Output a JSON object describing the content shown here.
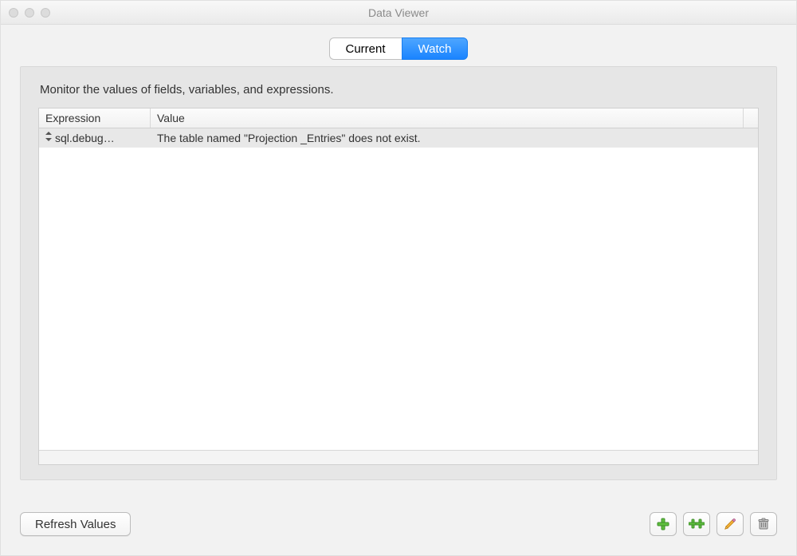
{
  "window": {
    "title": "Data Viewer"
  },
  "tabs": {
    "current": {
      "label": "Current",
      "active": false
    },
    "watch": {
      "label": "Watch",
      "active": true
    }
  },
  "instruction": "Monitor the values of fields, variables, and expressions.",
  "table": {
    "columns": {
      "expression": "Expression",
      "value": "Value"
    },
    "rows": [
      {
        "expression": "sql.debug…",
        "value": "The table named \"Projection _Entries\" does not exist."
      }
    ]
  },
  "buttons": {
    "refresh": "Refresh Values"
  },
  "icons": {
    "add": "add",
    "add_multi": "add-multiple",
    "edit": "edit",
    "delete": "delete"
  }
}
